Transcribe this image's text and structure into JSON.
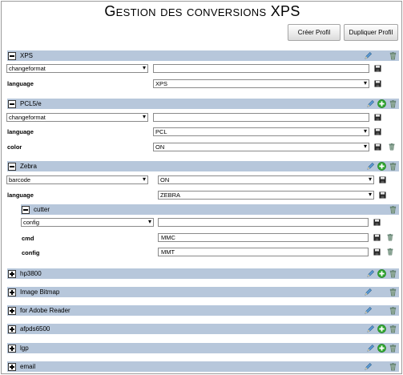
{
  "page": {
    "title": "Gestion des conversions XPS"
  },
  "toolbar": {
    "create_label": "Créer Profil",
    "duplicate_label": "Dupliquer Profil"
  },
  "sections": {
    "xps": {
      "name": "XPS",
      "param_key": "changeformat",
      "param_value": "",
      "rows": [
        {
          "label": "language",
          "value": "XPS"
        }
      ]
    },
    "pcl": {
      "name": "PCL5/e",
      "param_key": "changeformat",
      "param_value": "",
      "rows": [
        {
          "label": "language",
          "value": "PCL"
        },
        {
          "label": "color",
          "value": "ON"
        }
      ]
    },
    "zebra": {
      "name": "Zebra",
      "param_key": "barcode",
      "param_value": "ON",
      "rows": [
        {
          "label": "language",
          "value": "ZEBRA"
        }
      ],
      "sub": {
        "name": "cutter",
        "param_key": "config",
        "param_value": "",
        "rows": [
          {
            "label": "cmd",
            "value": "MMC"
          },
          {
            "label": "config",
            "value": "MMT"
          }
        ]
      }
    },
    "collapsed": [
      {
        "name": "hp3800"
      },
      {
        "name": "Image Bitmap"
      },
      {
        "name": "for Adobe Reader"
      },
      {
        "name": "afpds6500"
      },
      {
        "name": "lgp"
      },
      {
        "name": "email"
      }
    ]
  },
  "icons": {
    "edit": "pencil-icon",
    "add": "green-plus-icon",
    "delete": "trash-icon",
    "save": "floppy-save-icon",
    "collapse": "minus-box-icon",
    "expand": "plus-box-icon"
  },
  "colors": {
    "header_bg": "#b7c7db",
    "add_green": "#2fa52f"
  }
}
